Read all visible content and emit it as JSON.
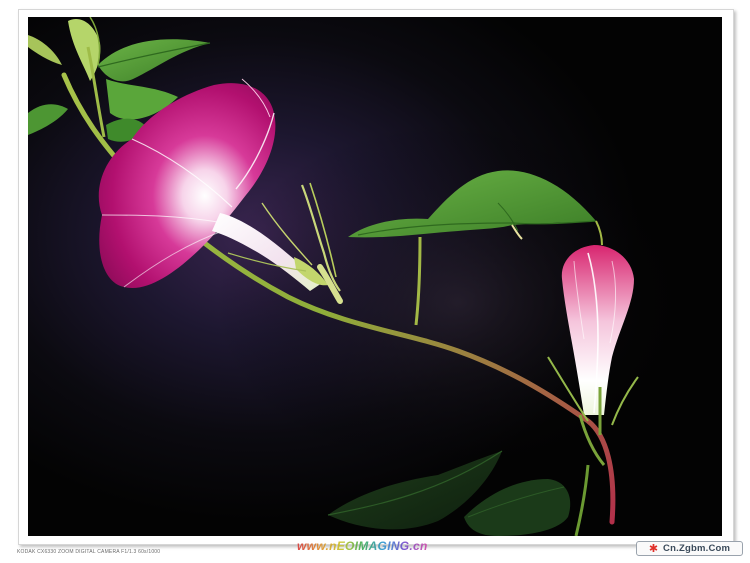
{
  "photo": {
    "subject": "morning-glory",
    "colors": {
      "background": "#050505",
      "petal": "#b2106f",
      "petal_light": "#f2bfe0",
      "bud": "#d8256f",
      "leaf": "#4f9a32",
      "stem": "#8fae3a"
    }
  },
  "captions": {
    "camera": "KODAK CX6330 ZOOM DIGITAL CAMERA F1/1.3 60s/1000",
    "watermark": "www.nEOIMAGING.cn",
    "site": "Cn.Zgbm.Com"
  }
}
